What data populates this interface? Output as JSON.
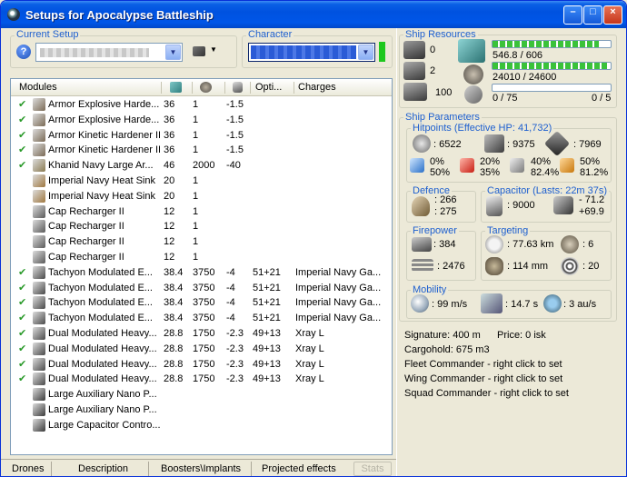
{
  "window": {
    "title": "Setups for Apocalypse Battleship"
  },
  "current_setup": {
    "label": "Current Setup",
    "value": ""
  },
  "character": {
    "label": "Character",
    "value": ""
  },
  "modules_header": {
    "col_modules": "Modules",
    "col_opti": "Opti...",
    "col_charges": "Charges"
  },
  "modules": [
    {
      "checked": true,
      "name": "Armor Explosive Harde...",
      "c1": "36",
      "c2": "1",
      "c3": "-1.5",
      "opti": "",
      "charges": "",
      "icon": "hardener-icon",
      "color": "#7a6a55"
    },
    {
      "checked": true,
      "name": "Armor Explosive Harde...",
      "c1": "36",
      "c2": "1",
      "c3": "-1.5",
      "opti": "",
      "charges": "",
      "icon": "hardener-icon",
      "color": "#7a6a55"
    },
    {
      "checked": true,
      "name": "Armor Kinetic Hardener II",
      "c1": "36",
      "c2": "1",
      "c3": "-1.5",
      "opti": "",
      "charges": "",
      "icon": "hardener-icon",
      "color": "#7a6a55"
    },
    {
      "checked": true,
      "name": "Armor Kinetic Hardener II",
      "c1": "36",
      "c2": "1",
      "c3": "-1.5",
      "opti": "",
      "charges": "",
      "icon": "hardener-icon",
      "color": "#7a6a55"
    },
    {
      "checked": true,
      "name": "Khanid Navy Large Ar...",
      "c1": "46",
      "c2": "2000",
      "c3": "-40",
      "opti": "",
      "charges": "",
      "icon": "armor-repairer-icon",
      "color": "#8a7a50"
    },
    {
      "checked": false,
      "name": "Imperial Navy Heat Sink",
      "c1": "20",
      "c2": "1",
      "c3": "",
      "opti": "",
      "charges": "",
      "icon": "heat-sink-icon",
      "color": "#a07840"
    },
    {
      "checked": false,
      "name": "Imperial Navy Heat Sink",
      "c1": "20",
      "c2": "1",
      "c3": "",
      "opti": "",
      "charges": "",
      "icon": "heat-sink-icon",
      "color": "#a07840"
    },
    {
      "checked": false,
      "name": "Cap Recharger II",
      "c1": "12",
      "c2": "1",
      "c3": "",
      "opti": "",
      "charges": "",
      "icon": "cap-recharger-icon",
      "color": "#5a5a5a"
    },
    {
      "checked": false,
      "name": "Cap Recharger II",
      "c1": "12",
      "c2": "1",
      "c3": "",
      "opti": "",
      "charges": "",
      "icon": "cap-recharger-icon",
      "color": "#5a5a5a"
    },
    {
      "checked": false,
      "name": "Cap Recharger II",
      "c1": "12",
      "c2": "1",
      "c3": "",
      "opti": "",
      "charges": "",
      "icon": "cap-recharger-icon",
      "color": "#5a5a5a"
    },
    {
      "checked": false,
      "name": "Cap Recharger II",
      "c1": "12",
      "c2": "1",
      "c3": "",
      "opti": "",
      "charges": "",
      "icon": "cap-recharger-icon",
      "color": "#5a5a5a"
    },
    {
      "checked": true,
      "name": "Tachyon Modulated E...",
      "c1": "38.4",
      "c2": "3750",
      "c3": "-4",
      "opti": "51+21",
      "charges": "Imperial Navy Ga...",
      "icon": "laser-turret-icon",
      "color": "#4a4a4a"
    },
    {
      "checked": true,
      "name": "Tachyon Modulated E...",
      "c1": "38.4",
      "c2": "3750",
      "c3": "-4",
      "opti": "51+21",
      "charges": "Imperial Navy Ga...",
      "icon": "laser-turret-icon",
      "color": "#4a4a4a"
    },
    {
      "checked": true,
      "name": "Tachyon Modulated E...",
      "c1": "38.4",
      "c2": "3750",
      "c3": "-4",
      "opti": "51+21",
      "charges": "Imperial Navy Ga...",
      "icon": "laser-turret-icon",
      "color": "#4a4a4a"
    },
    {
      "checked": true,
      "name": "Tachyon Modulated E...",
      "c1": "38.4",
      "c2": "3750",
      "c3": "-4",
      "opti": "51+21",
      "charges": "Imperial Navy Ga...",
      "icon": "laser-turret-icon",
      "color": "#4a4a4a"
    },
    {
      "checked": true,
      "name": "Dual Modulated Heavy...",
      "c1": "28.8",
      "c2": "1750",
      "c3": "-2.3",
      "opti": "49+13",
      "charges": "Xray L",
      "icon": "laser-turret-icon",
      "color": "#4a4a4a"
    },
    {
      "checked": true,
      "name": "Dual Modulated Heavy...",
      "c1": "28.8",
      "c2": "1750",
      "c3": "-2.3",
      "opti": "49+13",
      "charges": "Xray L",
      "icon": "laser-turret-icon",
      "color": "#4a4a4a"
    },
    {
      "checked": true,
      "name": "Dual Modulated Heavy...",
      "c1": "28.8",
      "c2": "1750",
      "c3": "-2.3",
      "opti": "49+13",
      "charges": "Xray L",
      "icon": "laser-turret-icon",
      "color": "#4a4a4a"
    },
    {
      "checked": true,
      "name": "Dual Modulated Heavy...",
      "c1": "28.8",
      "c2": "1750",
      "c3": "-2.3",
      "opti": "49+13",
      "charges": "Xray L",
      "icon": "laser-turret-icon",
      "color": "#4a4a4a"
    },
    {
      "checked": false,
      "name": "Large Auxiliary Nano P...",
      "c1": "",
      "c2": "",
      "c3": "",
      "opti": "",
      "charges": "",
      "icon": "rig-icon",
      "color": "#3a3a3a"
    },
    {
      "checked": false,
      "name": "Large Auxiliary Nano P...",
      "c1": "",
      "c2": "",
      "c3": "",
      "opti": "",
      "charges": "",
      "icon": "rig-icon",
      "color": "#3a3a3a"
    },
    {
      "checked": false,
      "name": "Large Capacitor Contro...",
      "c1": "",
      "c2": "",
      "c3": "",
      "opti": "",
      "charges": "",
      "icon": "rig-icon",
      "color": "#3a3a3a"
    }
  ],
  "bottom_tabs": [
    "Drones",
    "Description",
    "Boosters\\Implants",
    "Projected effects",
    "Stats"
  ],
  "resources": {
    "label": "Ship Resources",
    "hardpoints": [
      "0",
      "2",
      "100"
    ],
    "cpu_text": "546.8 / 606",
    "cpu_fraction": 0.9,
    "power_text": "24010 / 24600",
    "power_fraction": 0.976,
    "calibration_text": "0 / 75",
    "calibration_fraction": 0,
    "rig_text": "0 / 5"
  },
  "parameters": {
    "label": "Ship Parameters"
  },
  "hitpoints": {
    "label": "Hitpoints (Effective HP: 41,732)",
    "shield": ": 6522",
    "armor": ": 9375",
    "structure": ": 7969",
    "res": [
      {
        "a": "0%",
        "b": "50%"
      },
      {
        "a": "20%",
        "b": "35%"
      },
      {
        "a": "40%",
        "b": "82.4%"
      },
      {
        "a": "50%",
        "b": "81.2%"
      }
    ]
  },
  "defence": {
    "label": "Defence",
    "a": ": 266",
    "b": ": 275"
  },
  "capacitor": {
    "label": "Capacitor (Lasts: 22m 37s)",
    "cap": ": 9000",
    "rate1": "- 71.2",
    "rate2": "+69.9"
  },
  "firepower": {
    "label": "Firepower",
    "dps": ": 384",
    "volley": ": 2476"
  },
  "targeting": {
    "label": "Targeting",
    "range": ": 77.63 km",
    "targets": ": 6",
    "res": ": 114 mm",
    "sensor": ": 20"
  },
  "mobility": {
    "label": "Mobility",
    "speed": ": 99 m/s",
    "align": ": 14.7 s",
    "warp": ": 3 au/s"
  },
  "info": {
    "signature": "Signature: 400 m",
    "price": "Price: 0 isk",
    "cargo": "Cargohold: 675 m3",
    "fleet": "Fleet Commander - right click to set",
    "wing": "Wing Commander - right click to set",
    "squad": "Squad Commander - right click to set"
  }
}
